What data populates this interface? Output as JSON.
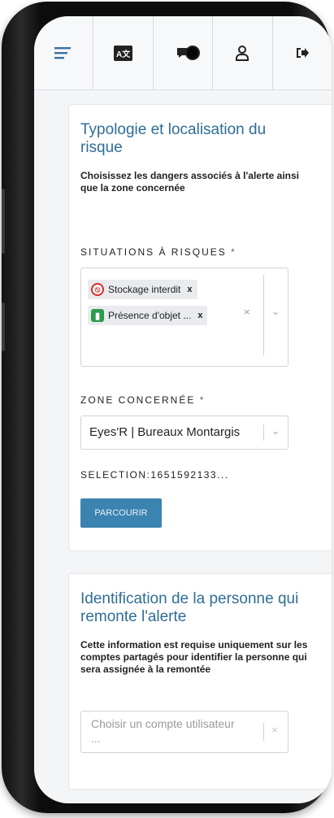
{
  "toolbar": {
    "items": [
      {
        "icon": "menu-icon"
      },
      {
        "icon": "translate-icon",
        "text": "A文"
      },
      {
        "icon": "chat-icon"
      },
      {
        "icon": "user-icon"
      },
      {
        "icon": "logout-icon"
      }
    ]
  },
  "risk_section": {
    "title": "Typologie et localisation du risque",
    "description": "Choisissez les dangers associés à l'alerte ainsi que la zone concernée",
    "situations_label": "SITUATIONS À RISQUES",
    "required_mark": "*",
    "tags": [
      {
        "label": "Stockage interdit",
        "icon": "no-entry-icon",
        "color": "#d92c2c",
        "remove": "x"
      },
      {
        "label": "Présence d'objet ...",
        "icon": "exit-sign-icon",
        "color": "#2e9b4e",
        "remove": "x"
      }
    ],
    "clear_symbol": "×",
    "zone_label": "ZONE CONCERNÉE",
    "zone_value": "Eyes'R | Bureaux Montargis",
    "selection_text": "SELECTION:1651592133...",
    "browse_button": "PARCOURIR"
  },
  "person_section": {
    "title": "Identification de la personne qui remonte l'alerte",
    "description": "Cette information est requise uniquement sur les comptes partagés pour identifier la personne qui sera assignée à la remontée",
    "account_placeholder": "Choisir un compte utilisateur ...",
    "clear_symbol": "×"
  },
  "colors": {
    "accent": "#2f6d96",
    "button": "#3b83b1"
  }
}
